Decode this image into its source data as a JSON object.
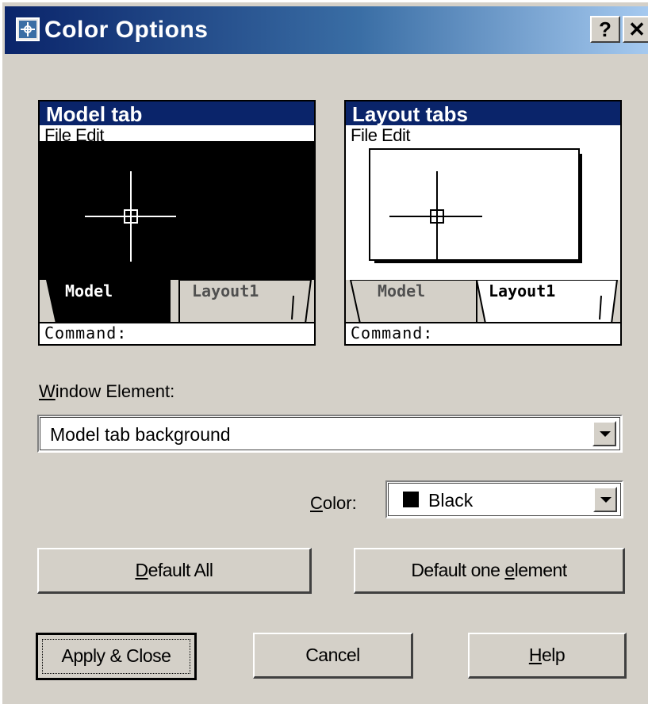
{
  "window": {
    "title": "Color Options",
    "help_caption": "?",
    "close_caption": "✕"
  },
  "model_preview": {
    "title": "Model tab",
    "menu": "File  Edit",
    "tabs": [
      "Model",
      "Layout1"
    ],
    "command": "Command:"
  },
  "layout_preview": {
    "title": "Layout tabs",
    "menu": "File  Edit",
    "tabs": [
      "Model",
      "Layout1"
    ],
    "command": "Command:"
  },
  "window_element": {
    "label_u": "W",
    "label_rest": "indow Element:",
    "value": "Model tab background"
  },
  "color": {
    "label_u": "C",
    "label_rest": "olor:",
    "value": "Black",
    "swatch": "#000000"
  },
  "buttons": {
    "default_all_u": "D",
    "default_all_rest": "efault All",
    "default_one_pre": "Default one ",
    "default_one_u": "e",
    "default_one_rest": "lement",
    "apply_close": "Apply & Close",
    "cancel": "Cancel",
    "help_u": "H",
    "help_rest": "elp"
  },
  "colors": {
    "title_bar": "#0a246a",
    "dialog_face": "#d4d0c8"
  }
}
